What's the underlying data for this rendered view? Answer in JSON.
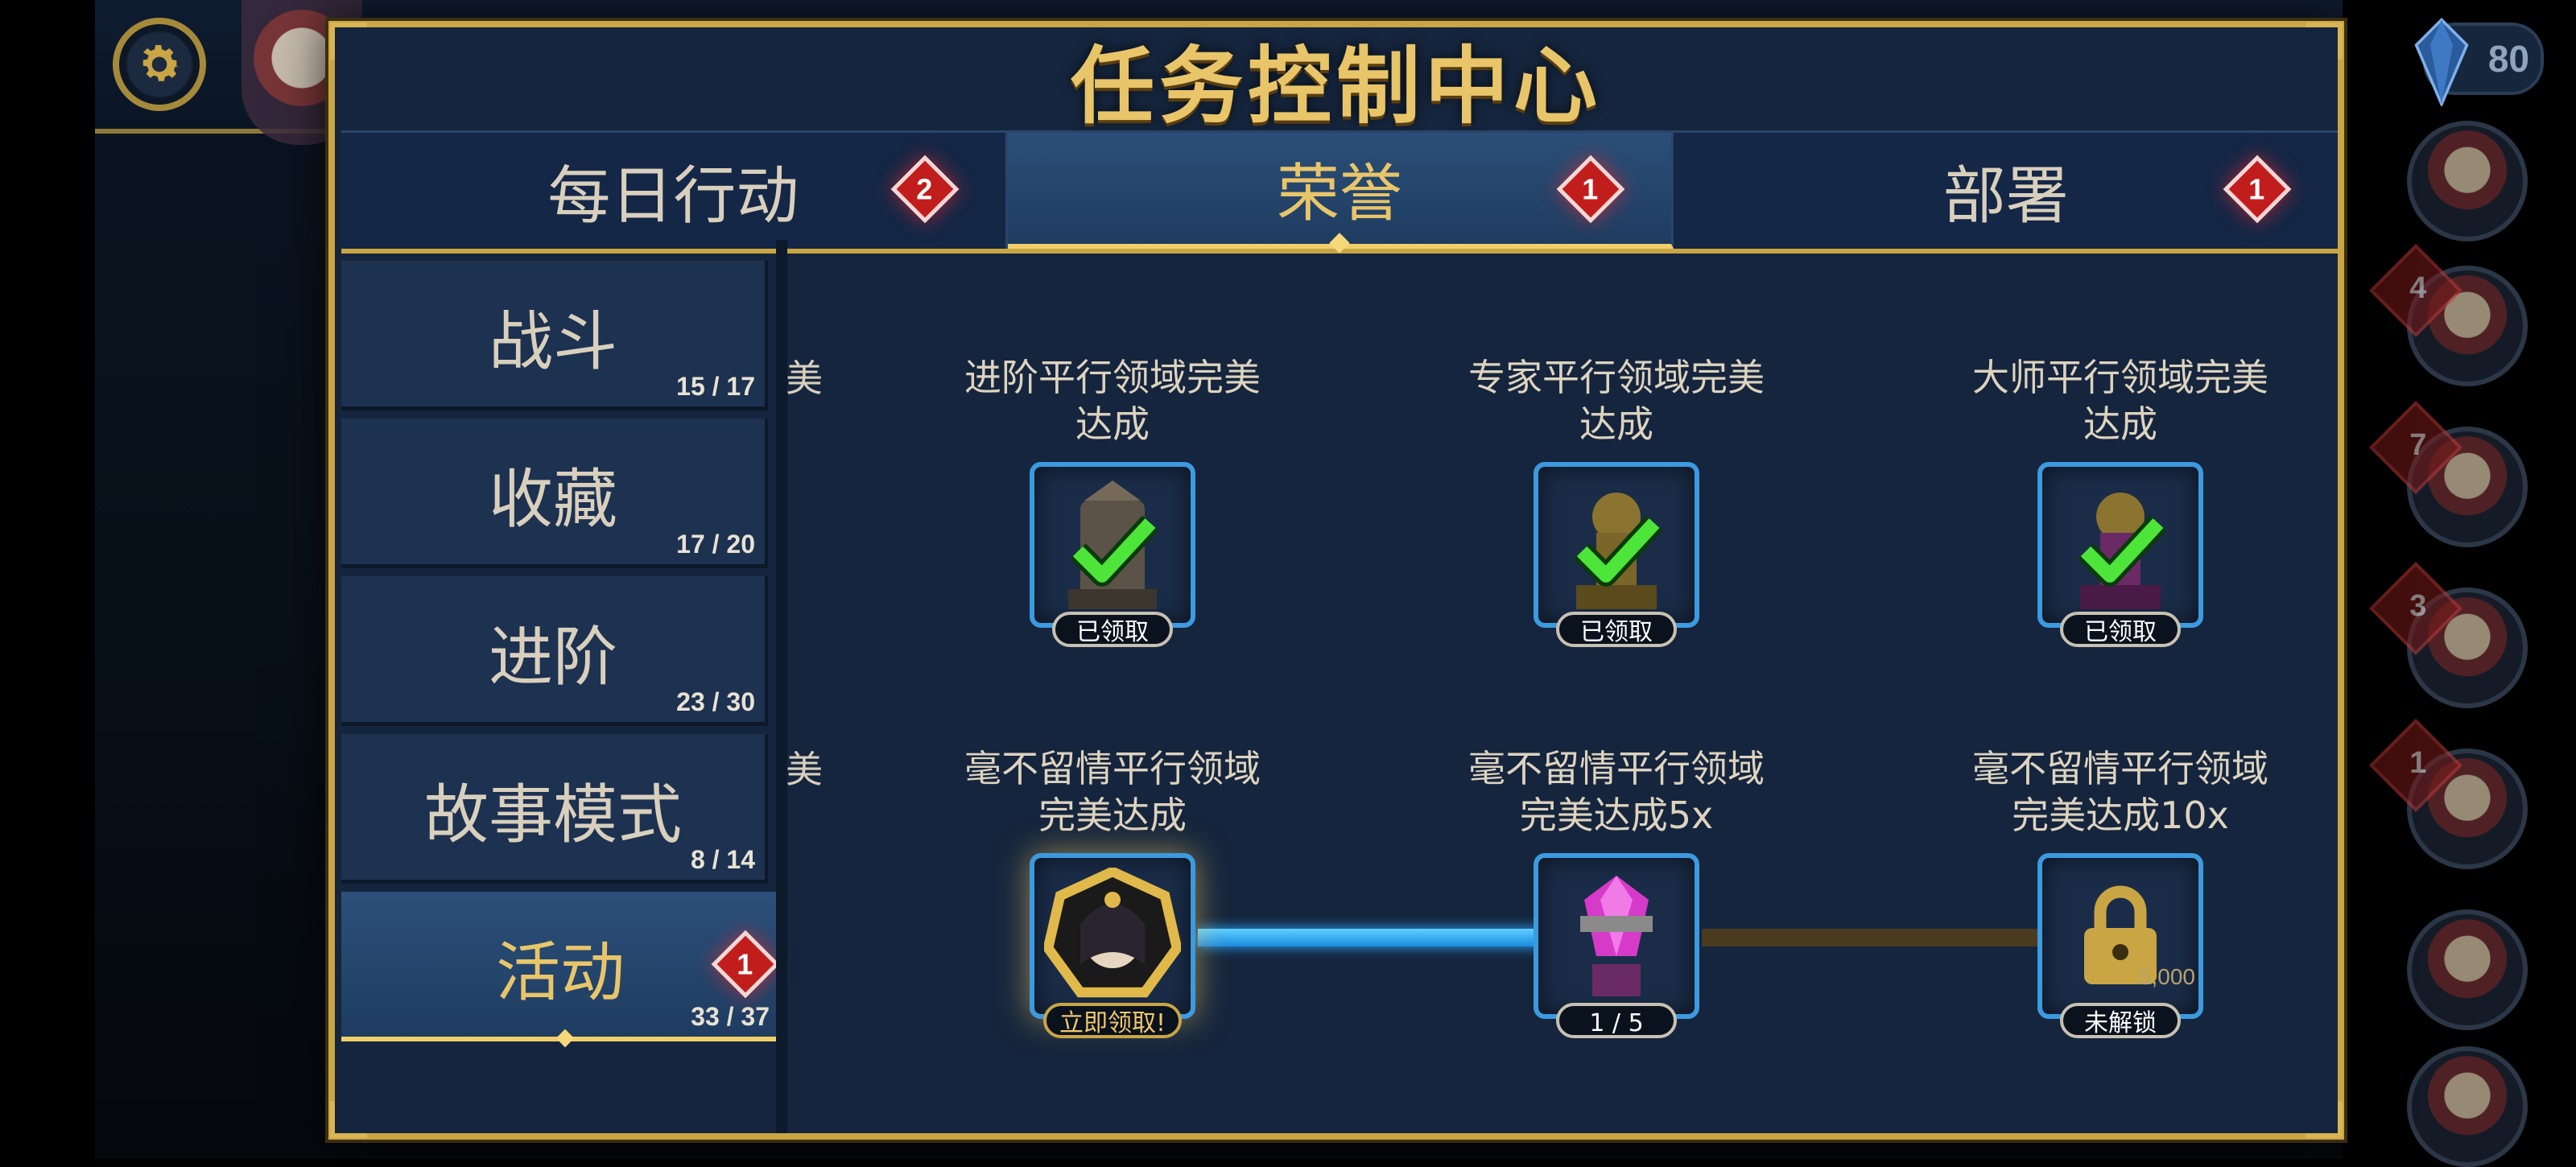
{
  "title": "任务控制中心",
  "currency": {
    "gems": "80"
  },
  "tabs": [
    {
      "label": "每日行动",
      "badge": "2"
    },
    {
      "label": "荣誉",
      "badge": "1"
    },
    {
      "label": "部署",
      "badge": "1"
    }
  ],
  "categories": [
    {
      "label": "战斗",
      "count": "15 / 17"
    },
    {
      "label": "收藏",
      "count": "17 / 20"
    },
    {
      "label": "进阶",
      "count": "23 / 30"
    },
    {
      "label": "故事模式",
      "count": "8 / 14"
    },
    {
      "label": "活动",
      "count": "33 / 37",
      "badge": "1"
    }
  ],
  "side_badges": [
    "4",
    "7",
    "3",
    "1"
  ],
  "cut_labels": [
    "美",
    "美"
  ],
  "rewards_row1": [
    {
      "title_line1": "进阶平行领域完美",
      "title_line2": "达成",
      "status": "已领取"
    },
    {
      "title_line1": "专家平行领域完美",
      "title_line2": "达成",
      "status": "已领取"
    },
    {
      "title_line1": "大师平行领域完美",
      "title_line2": "达成",
      "status": "已领取"
    }
  ],
  "rewards_row2": [
    {
      "title_line1": "毫不留情平行领域",
      "title_line2": "完美达成",
      "status": "立即领取!"
    },
    {
      "title_line1": "毫不留情平行领域",
      "title_line2": "完美达成5x",
      "status": "1 / 5"
    },
    {
      "title_line1": "毫不留情平行领域",
      "title_line2": "完美达成10x",
      "status": "未解锁",
      "cost": "5,000"
    }
  ],
  "colors": {
    "gold": "#c9a544",
    "panel": "#15253d",
    "badge_red": "#c21d1d",
    "progress_blue": "#2aa8ff"
  }
}
